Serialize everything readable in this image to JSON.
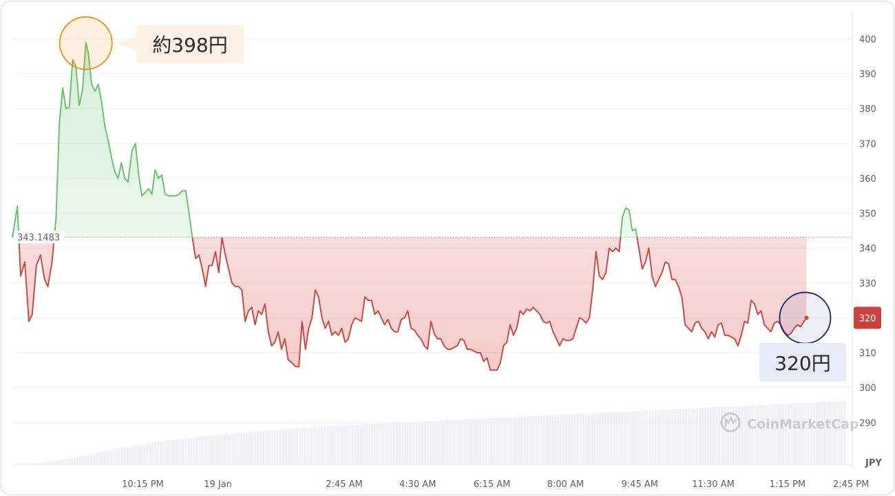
{
  "chart_data": {
    "type": "line",
    "currency": "JPY",
    "baseline": {
      "label": "343.1483",
      "value": 343.1483
    },
    "current_label": "320",
    "ylim": [
      278,
      408
    ],
    "yticks": [
      {
        "label": "400",
        "value": 400
      },
      {
        "label": "390",
        "value": 390
      },
      {
        "label": "380",
        "value": 380
      },
      {
        "label": "370",
        "value": 370
      },
      {
        "label": "360",
        "value": 360
      },
      {
        "label": "350",
        "value": 350
      },
      {
        "label": "340",
        "value": 340
      },
      {
        "label": "330",
        "value": 330
      },
      {
        "label": "320",
        "value": 320
      },
      {
        "label": "310",
        "value": 310
      },
      {
        "label": "300",
        "value": 300
      },
      {
        "label": "290",
        "value": 290
      }
    ],
    "xticks": [
      {
        "label": "10:15 PM",
        "value": 0.158
      },
      {
        "label": "19 Jan",
        "value": 0.249
      },
      {
        "label": "2:45 AM",
        "value": 0.402
      },
      {
        "label": "4:30 AM",
        "value": 0.491
      },
      {
        "label": "6:15 AM",
        "value": 0.581
      },
      {
        "label": "8:00 AM",
        "value": 0.67
      },
      {
        "label": "9:45 AM",
        "value": 0.76
      },
      {
        "label": "11:30 AM",
        "value": 0.849
      },
      {
        "label": "1:15 PM",
        "value": 0.939
      },
      {
        "label": "2:45 PM",
        "value": 1.016
      }
    ],
    "series": [
      {
        "values": [
          [
            0.0,
            343.1
          ],
          [
            0.006,
            352
          ],
          [
            0.01,
            332
          ],
          [
            0.015,
            336
          ],
          [
            0.02,
            319
          ],
          [
            0.024,
            321
          ],
          [
            0.029,
            335
          ],
          [
            0.034,
            338
          ],
          [
            0.039,
            331
          ],
          [
            0.043,
            329
          ],
          [
            0.048,
            336
          ],
          [
            0.053,
            349
          ],
          [
            0.057,
            376
          ],
          [
            0.061,
            386
          ],
          [
            0.065,
            380
          ],
          [
            0.069,
            380.5
          ],
          [
            0.073,
            394
          ],
          [
            0.077,
            392
          ],
          [
            0.081,
            381
          ],
          [
            0.085,
            385.5
          ],
          [
            0.089,
            399
          ],
          [
            0.092,
            396
          ],
          [
            0.096,
            387
          ],
          [
            0.1,
            385
          ],
          [
            0.104,
            387
          ],
          [
            0.108,
            382
          ],
          [
            0.112,
            375
          ],
          [
            0.116,
            371
          ],
          [
            0.12,
            366
          ],
          [
            0.124,
            362
          ],
          [
            0.128,
            360
          ],
          [
            0.132,
            364.5
          ],
          [
            0.136,
            360
          ],
          [
            0.14,
            359
          ],
          [
            0.145,
            368
          ],
          [
            0.149,
            370
          ],
          [
            0.153,
            361
          ],
          [
            0.157,
            355
          ],
          [
            0.161,
            356
          ],
          [
            0.165,
            357
          ],
          [
            0.169,
            355.5
          ],
          [
            0.173,
            362.5
          ],
          [
            0.177,
            360
          ],
          [
            0.181,
            361
          ],
          [
            0.185,
            355.5
          ],
          [
            0.189,
            355
          ],
          [
            0.193,
            355
          ],
          [
            0.198,
            355
          ],
          [
            0.202,
            355.5
          ],
          [
            0.206,
            356.5
          ],
          [
            0.21,
            356.5
          ],
          [
            0.214,
            350
          ],
          [
            0.218,
            343
          ],
          [
            0.222,
            337
          ],
          [
            0.226,
            338
          ],
          [
            0.23,
            334
          ],
          [
            0.234,
            329
          ],
          [
            0.238,
            335
          ],
          [
            0.242,
            335
          ],
          [
            0.246,
            339
          ],
          [
            0.25,
            333
          ],
          [
            0.254,
            343
          ],
          [
            0.258,
            338
          ],
          [
            0.262,
            334
          ],
          [
            0.266,
            330
          ],
          [
            0.27,
            329
          ],
          [
            0.274,
            329
          ],
          [
            0.278,
            328
          ],
          [
            0.282,
            319
          ],
          [
            0.286,
            322
          ],
          [
            0.29,
            323
          ],
          [
            0.294,
            318
          ],
          [
            0.298,
            322
          ],
          [
            0.302,
            321
          ],
          [
            0.306,
            324
          ],
          [
            0.31,
            316
          ],
          [
            0.314,
            312
          ],
          [
            0.318,
            313
          ],
          [
            0.322,
            316
          ],
          [
            0.326,
            311
          ],
          [
            0.33,
            314
          ],
          [
            0.334,
            308
          ],
          [
            0.339,
            307
          ],
          [
            0.343,
            306
          ],
          [
            0.347,
            306
          ],
          [
            0.351,
            319
          ],
          [
            0.355,
            311
          ],
          [
            0.359,
            317
          ],
          [
            0.363,
            320
          ],
          [
            0.367,
            328
          ],
          [
            0.371,
            326
          ],
          [
            0.375,
            320
          ],
          [
            0.379,
            317
          ],
          [
            0.383,
            319
          ],
          [
            0.387,
            315
          ],
          [
            0.391,
            316
          ],
          [
            0.395,
            315
          ],
          [
            0.399,
            317
          ],
          [
            0.403,
            313
          ],
          [
            0.407,
            314
          ],
          [
            0.411,
            318
          ],
          [
            0.415,
            320
          ],
          [
            0.419,
            319.5
          ],
          [
            0.423,
            319
          ],
          [
            0.427,
            326
          ],
          [
            0.431,
            325
          ],
          [
            0.435,
            325
          ],
          [
            0.439,
            321
          ],
          [
            0.443,
            322
          ],
          [
            0.447,
            320
          ],
          [
            0.451,
            318
          ],
          [
            0.455,
            319.5
          ],
          [
            0.459,
            317
          ],
          [
            0.463,
            316
          ],
          [
            0.467,
            316
          ],
          [
            0.471,
            319.5
          ],
          [
            0.475,
            320
          ],
          [
            0.479,
            322
          ],
          [
            0.483,
            317
          ],
          [
            0.487,
            316.5
          ],
          [
            0.491,
            315
          ],
          [
            0.495,
            314
          ],
          [
            0.499,
            312
          ],
          [
            0.503,
            311
          ],
          [
            0.507,
            319
          ],
          [
            0.511,
            315.5
          ],
          [
            0.515,
            314
          ],
          [
            0.519,
            314
          ],
          [
            0.523,
            312
          ],
          [
            0.527,
            311
          ],
          [
            0.531,
            311
          ],
          [
            0.535,
            311.5
          ],
          [
            0.539,
            312
          ],
          [
            0.543,
            314
          ],
          [
            0.547,
            313.5
          ],
          [
            0.551,
            311
          ],
          [
            0.555,
            311
          ],
          [
            0.559,
            310.5
          ],
          [
            0.563,
            310
          ],
          [
            0.567,
            310
          ],
          [
            0.571,
            307.5
          ],
          [
            0.575,
            308.5
          ],
          [
            0.579,
            305
          ],
          [
            0.583,
            305
          ],
          [
            0.587,
            305
          ],
          [
            0.591,
            307
          ],
          [
            0.595,
            312
          ],
          [
            0.599,
            313
          ],
          [
            0.603,
            318
          ],
          [
            0.607,
            315
          ],
          [
            0.611,
            317
          ],
          [
            0.615,
            322
          ],
          [
            0.619,
            321
          ],
          [
            0.623,
            322.5
          ],
          [
            0.627,
            322
          ],
          [
            0.631,
            323
          ],
          [
            0.635,
            322
          ],
          [
            0.639,
            321
          ],
          [
            0.643,
            319
          ],
          [
            0.647,
            318.5
          ],
          [
            0.651,
            319
          ],
          [
            0.655,
            316
          ],
          [
            0.659,
            314
          ],
          [
            0.663,
            312
          ],
          [
            0.667,
            314
          ],
          [
            0.671,
            313.5
          ],
          [
            0.675,
            313.5
          ],
          [
            0.679,
            314
          ],
          [
            0.683,
            317
          ],
          [
            0.687,
            320
          ],
          [
            0.691,
            319.5
          ],
          [
            0.695,
            318.5
          ],
          [
            0.699,
            320
          ],
          [
            0.703,
            328
          ],
          [
            0.707,
            339
          ],
          [
            0.711,
            332
          ],
          [
            0.715,
            331
          ],
          [
            0.719,
            333
          ],
          [
            0.723,
            340
          ],
          [
            0.727,
            339
          ],
          [
            0.731,
            340
          ],
          [
            0.735,
            339
          ],
          [
            0.739,
            349
          ],
          [
            0.743,
            351.5
          ],
          [
            0.747,
            351
          ],
          [
            0.751,
            345
          ],
          [
            0.755,
            345.5
          ],
          [
            0.759,
            340
          ],
          [
            0.763,
            334
          ],
          [
            0.767,
            336
          ],
          [
            0.771,
            340
          ],
          [
            0.775,
            332
          ],
          [
            0.779,
            329
          ],
          [
            0.783,
            331
          ],
          [
            0.787,
            333
          ],
          [
            0.791,
            336
          ],
          [
            0.795,
            335.5
          ],
          [
            0.799,
            331
          ],
          [
            0.803,
            331
          ],
          [
            0.807,
            329
          ],
          [
            0.811,
            326
          ],
          [
            0.815,
            318
          ],
          [
            0.819,
            317
          ],
          [
            0.823,
            316
          ],
          [
            0.827,
            318.5
          ],
          [
            0.831,
            319
          ],
          [
            0.835,
            317
          ],
          [
            0.839,
            316
          ],
          [
            0.843,
            314
          ],
          [
            0.847,
            316
          ],
          [
            0.851,
            314.5
          ],
          [
            0.855,
            318
          ],
          [
            0.859,
            318.5
          ],
          [
            0.863,
            315
          ],
          [
            0.867,
            315
          ],
          [
            0.871,
            314.5
          ],
          [
            0.875,
            314
          ],
          [
            0.879,
            312
          ],
          [
            0.883,
            315
          ],
          [
            0.887,
            319
          ],
          [
            0.891,
            318.5
          ],
          [
            0.895,
            325
          ],
          [
            0.899,
            324
          ],
          [
            0.903,
            321
          ],
          [
            0.907,
            322
          ],
          [
            0.911,
            318
          ],
          [
            0.915,
            317
          ],
          [
            0.919,
            316
          ],
          [
            0.923,
            318.5
          ],
          [
            0.927,
            319
          ],
          [
            0.931,
            318
          ],
          [
            0.935,
            316
          ],
          [
            0.939,
            315
          ],
          [
            0.943,
            315.5
          ],
          [
            0.947,
            317
          ],
          [
            0.951,
            318
          ],
          [
            0.955,
            317.5
          ],
          [
            0.959,
            319
          ],
          [
            0.962,
            320
          ]
        ]
      }
    ],
    "volume_values": [
      0.01,
      0.02,
      0.08,
      0.16,
      0.25,
      0.32,
      0.38,
      0.43,
      0.47,
      0.51,
      0.54,
      0.57,
      0.6,
      0.62,
      0.64,
      0.66,
      0.68,
      0.7,
      0.72,
      0.74,
      0.76,
      0.78,
      0.8,
      0.82,
      0.84,
      0.86,
      0.88,
      0.9,
      0.92,
      0.94,
      0.96,
      0.98,
      1.0
    ]
  },
  "colors": {
    "up": "#16c784",
    "up_line": "#6fbf73",
    "down_line": "#c94a45",
    "current_badge": "#c9403d",
    "high_marker": "#ef8c10",
    "current_marker": "#1a2366"
  },
  "callouts": {
    "high": "約398円",
    "current": "320円"
  },
  "watermark": {
    "icon": "coinmarketcap-logo-icon",
    "text": "CoinMarketCap"
  }
}
